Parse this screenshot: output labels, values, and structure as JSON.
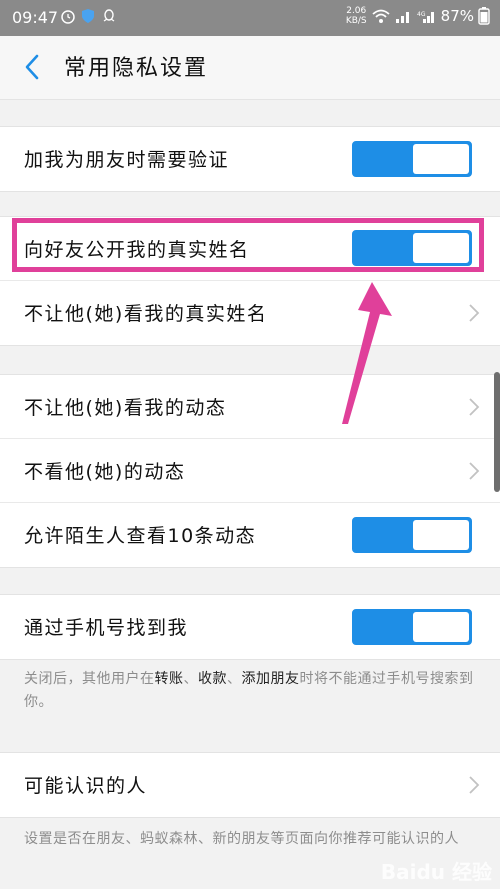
{
  "status_bar": {
    "time": "09:47",
    "speed": "2.06",
    "speed_unit": "KB/S",
    "battery": "87%"
  },
  "header": {
    "title": "常用隐私设置"
  },
  "settings": {
    "verify_friend": {
      "label": "加我为朋友时需要验证",
      "enabled": true
    },
    "show_real_name": {
      "label": "向好友公开我的真实姓名",
      "enabled": true
    },
    "hide_real_name_from": {
      "label": "不让他(她)看我的真实姓名"
    },
    "hide_moments_from": {
      "label": "不让他(她)看我的动态"
    },
    "not_see_moments": {
      "label": "不看他(她)的动态"
    },
    "stranger_view_10": {
      "label": "允许陌生人查看10条动态",
      "enabled": true
    },
    "find_by_phone": {
      "label": "通过手机号找到我",
      "enabled": true
    },
    "find_by_phone_note": {
      "p1": "关闭后，其他用户在",
      "b1": "转账",
      "p2": "、",
      "b2": "收款",
      "p3": "、",
      "b3": "添加朋友",
      "p4": "时将不能通过手机号搜索到你。"
    },
    "people_you_may_know": {
      "label": "可能认识的人"
    },
    "people_note": "设置是否在朋友、蚂蚁森林、新的朋友等页面向你推荐可能认识的人"
  },
  "watermark": "Baidu 经验",
  "colors": {
    "toggle_on": "#1e8ee6",
    "highlight": "#e0409a",
    "back_arrow": "#1e8ee6"
  },
  "icons": {
    "back": "chevron-left-icon",
    "row_arrow": "chevron-right-icon",
    "alarm": "alarm-icon",
    "shield": "shield-icon",
    "qq": "qq-icon",
    "wifi": "wifi-icon",
    "signal": "signal-icon",
    "battery": "battery-icon"
  }
}
